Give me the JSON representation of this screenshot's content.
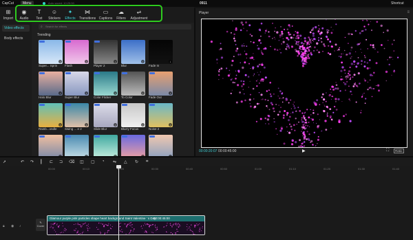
{
  "titlebar": {
    "app": "CapCut",
    "menu": "Menu",
    "autosave": "Auto saved: 10:25:50",
    "project": "0911",
    "shortcuts": "Shortcut"
  },
  "toolbar": {
    "items": [
      {
        "label": "Import",
        "icon": "import-icon",
        "glyph": "⊞"
      },
      {
        "label": "Audio",
        "icon": "audio-icon",
        "glyph": "◉"
      },
      {
        "label": "Text",
        "icon": "text-icon",
        "glyph": "T"
      },
      {
        "label": "Stickers",
        "icon": "stickers-icon",
        "glyph": "☺"
      },
      {
        "label": "Effects",
        "icon": "effects-icon",
        "glyph": "✦"
      },
      {
        "label": "Transitions",
        "icon": "transitions-icon",
        "glyph": "⋈"
      },
      {
        "label": "Captions",
        "icon": "captions-icon",
        "glyph": "▭"
      },
      {
        "label": "Filters",
        "icon": "filters-icon",
        "glyph": "☁"
      },
      {
        "label": "Adjustment",
        "icon": "adjustment-icon",
        "glyph": "⇌"
      }
    ],
    "active": "Effects",
    "highlight_color": "#2ecc1e"
  },
  "sidenav": {
    "items": [
      "Video effects",
      "Body effects"
    ],
    "active": "Video effects"
  },
  "panel": {
    "search_placeholder": "Search for effects",
    "section": "Trending",
    "effects": [
      {
        "label": "Super... Sprin",
        "c1": "#8ab8e8",
        "c2": "#d8e8f8"
      },
      {
        "label": "Flash",
        "c1": "#d86ad0",
        "c2": "#f0c8ea"
      },
      {
        "label": "Player 2",
        "c1": "#333333",
        "c2": "#888888"
      },
      {
        "label": "Blur",
        "c1": "#3c6fc8",
        "c2": "#a0c0e8"
      },
      {
        "label": "Fade In",
        "c1": "#050505",
        "c2": "#111111"
      },
      {
        "label": "Halo Blur",
        "c1": "#e8b0a0",
        "c2": "#5a6a8a"
      },
      {
        "label": "Super Blur",
        "c1": "#d8d8e8",
        "c2": "#8898c0"
      },
      {
        "label": "Color Flicker",
        "c1": "#2a7a88",
        "c2": "#9ad8d0"
      },
      {
        "label": "To Color",
        "c1": "#555555",
        "c2": "#bbbbbb"
      },
      {
        "label": "Fade Out",
        "c1": "#e8a070",
        "c2": "#7a8aa8"
      },
      {
        "label": "Rainb...ondle",
        "c1": "#60c0b8",
        "c2": "#e8b040"
      },
      {
        "label": "Swing ... e 2",
        "c1": "#3a88a8",
        "c2": "#e0c0a8"
      },
      {
        "label": "Slide Blur",
        "c1": "#dcdce8",
        "c2": "#a8a8c0"
      },
      {
        "label": "Blurry Focus",
        "c1": "#c8c8c8",
        "c2": "#f0f0f0"
      },
      {
        "label": "Noise 2",
        "c1": "#6ab8c8",
        "c2": "#e0c060"
      },
      {
        "label": "",
        "c1": "#f0c0a0",
        "c2": "#7a88a8"
      },
      {
        "label": "",
        "c1": "#4a8ab0",
        "c2": "#c8e0e8"
      },
      {
        "label": "",
        "c1": "#40a8a0",
        "c2": "#c8f0e0"
      },
      {
        "label": "",
        "c1": "#6a6ae0",
        "c2": "#f0a0a0"
      },
      {
        "label": "",
        "c1": "#f0c8b0",
        "c2": "#8aa0c0"
      }
    ]
  },
  "player": {
    "title": "Player",
    "current_time": "00:00:20:07",
    "total_time": "00:00:45:00",
    "ratio": "Ratio"
  },
  "timeline": {
    "ticks": [
      "00:00",
      "00:10",
      "00:20",
      "00:30",
      "00:40",
      "00:50",
      "01:00",
      "01:10",
      "01:20",
      "01:30",
      "01:40"
    ],
    "clip_name": "Glamour purple pink particles shape heart background Saint Valentine ' s Day",
    "clip_duration": "00:00:45:00",
    "cover": "Cover"
  }
}
